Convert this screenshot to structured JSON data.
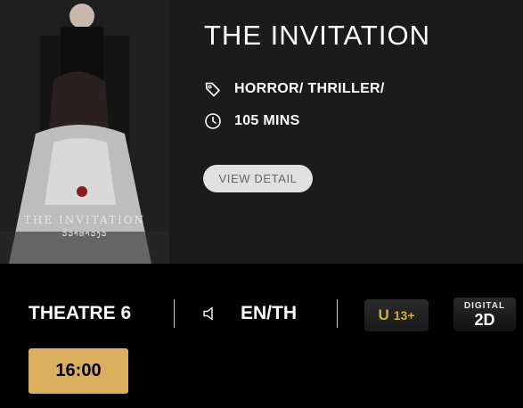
{
  "movie": {
    "title": "THE INVITATION",
    "genre": "HORROR/ THRILLER/",
    "duration": "105 MINS",
    "view_detail_label": "VIEW DETAIL",
    "poster": {
      "title_text": "THE INVITATION",
      "subtitle_text": "ວິວາທາວງວ"
    }
  },
  "showtime": {
    "theatre": "THEATRE 6",
    "language": "EN/TH",
    "rating": {
      "prefix": "U",
      "label": "13+"
    },
    "format": {
      "top": "DIGITAL",
      "value": "2D"
    },
    "time": "16:00"
  },
  "icons": {
    "genre": "tag-icon",
    "duration": "clock-icon",
    "language": "speaker-icon"
  },
  "colors": {
    "background": "#000000",
    "panel": "#1b1b1b",
    "accent_gold": "#d9ae5d",
    "rating_gold": "#d4a93f"
  }
}
